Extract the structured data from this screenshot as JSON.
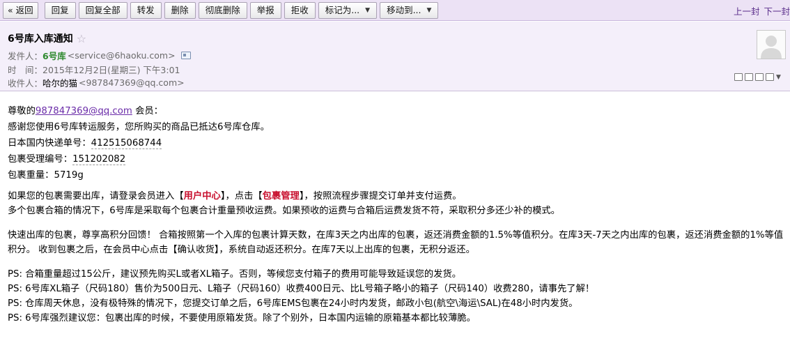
{
  "toolbar": {
    "back": "« 返回",
    "buttons": [
      "回复",
      "回复全部",
      "转发",
      "删除",
      "彻底删除",
      "举报",
      "拒收"
    ],
    "dropdowns": [
      "标记为...",
      "移动到..."
    ],
    "prev": "上一封",
    "next": "下一封"
  },
  "header": {
    "subject": "6号库入库通知",
    "from_label": "发件人：",
    "from_name": "6号库",
    "from_addr": "<service@6haoku.com>",
    "time_label": "时　间：",
    "time_value": "2015年12月2日(星期三) 下午3:01",
    "to_label": "收件人：",
    "to_name": "哈尔的猫",
    "to_addr": "<987847369@qq.com>"
  },
  "body": {
    "greeting_pre": "尊敬的",
    "greeting_link": "987847369@qq.com",
    "greeting_post": " 会员：",
    "line1": "感谢您使用6号库转运服务，您所购买的商品已抵达6号库仓库。",
    "tracking_label": "日本国内快递单号：",
    "tracking_value": "412515068744",
    "parcel_label": "包裹受理编号：",
    "parcel_value": "151202082",
    "weight_label": "包裹重量：",
    "weight_value": "5719g",
    "p2_a": "如果您的包裹需要出库，请登录会员进入【",
    "p2_user_center": "用户中心",
    "p2_b": "】，点击【",
    "p2_parcel_mgmt": "包裹管理",
    "p2_c": "】，按照流程步骤提交订单并支付运费。",
    "p2_line2": "多个包裹合箱的情况下，6号库是采取每个包裹合计重量预收运费。如果预收的运费与合箱后运费发货不符，采取积分多还少补的模式。",
    "p3": "快速出库的包裹，尊享高积分回馈！ 合箱按照第一个入库的包裹计算天数，在库3天之内出库的包裹，返还消费金额的1.5%等值积分。在库3天-7天之内出库的包裹，返还消费金额的1%等值积分。 收到包裹之后，在会员中心点击【确认收货】，系统自动返还积分。在库7天以上出库的包裹，无积分返还。",
    "ps1": "PS: 合箱重量超过15公斤，建议预先购买L或者XL箱子。否则，等候您支付箱子的费用可能导致延误您的发货。",
    "ps2": "PS: 6号库XL箱子（尺码180）售价为500日元、L箱子（尺码160）收费400日元、比L号箱子略小的箱子（尺码140）收费280，请事先了解！",
    "ps3": "PS: 仓库周天休息，没有极特殊的情况下，您提交订单之后，6号库EMS包裹在24小时内发货，邮政小包(航空\\海运\\SAL)在48小时内发货。",
    "ps4": "PS: 6号库强烈建议您：包裹出库的时候，不要使用原箱发货。除了个别外，日本国内运输的原箱基本都比较薄脆。"
  },
  "icons": [
    "star-icon",
    "contact-card-icon",
    "avatar-icon",
    "caret-down-icon",
    "window-icon",
    "print-icon"
  ]
}
